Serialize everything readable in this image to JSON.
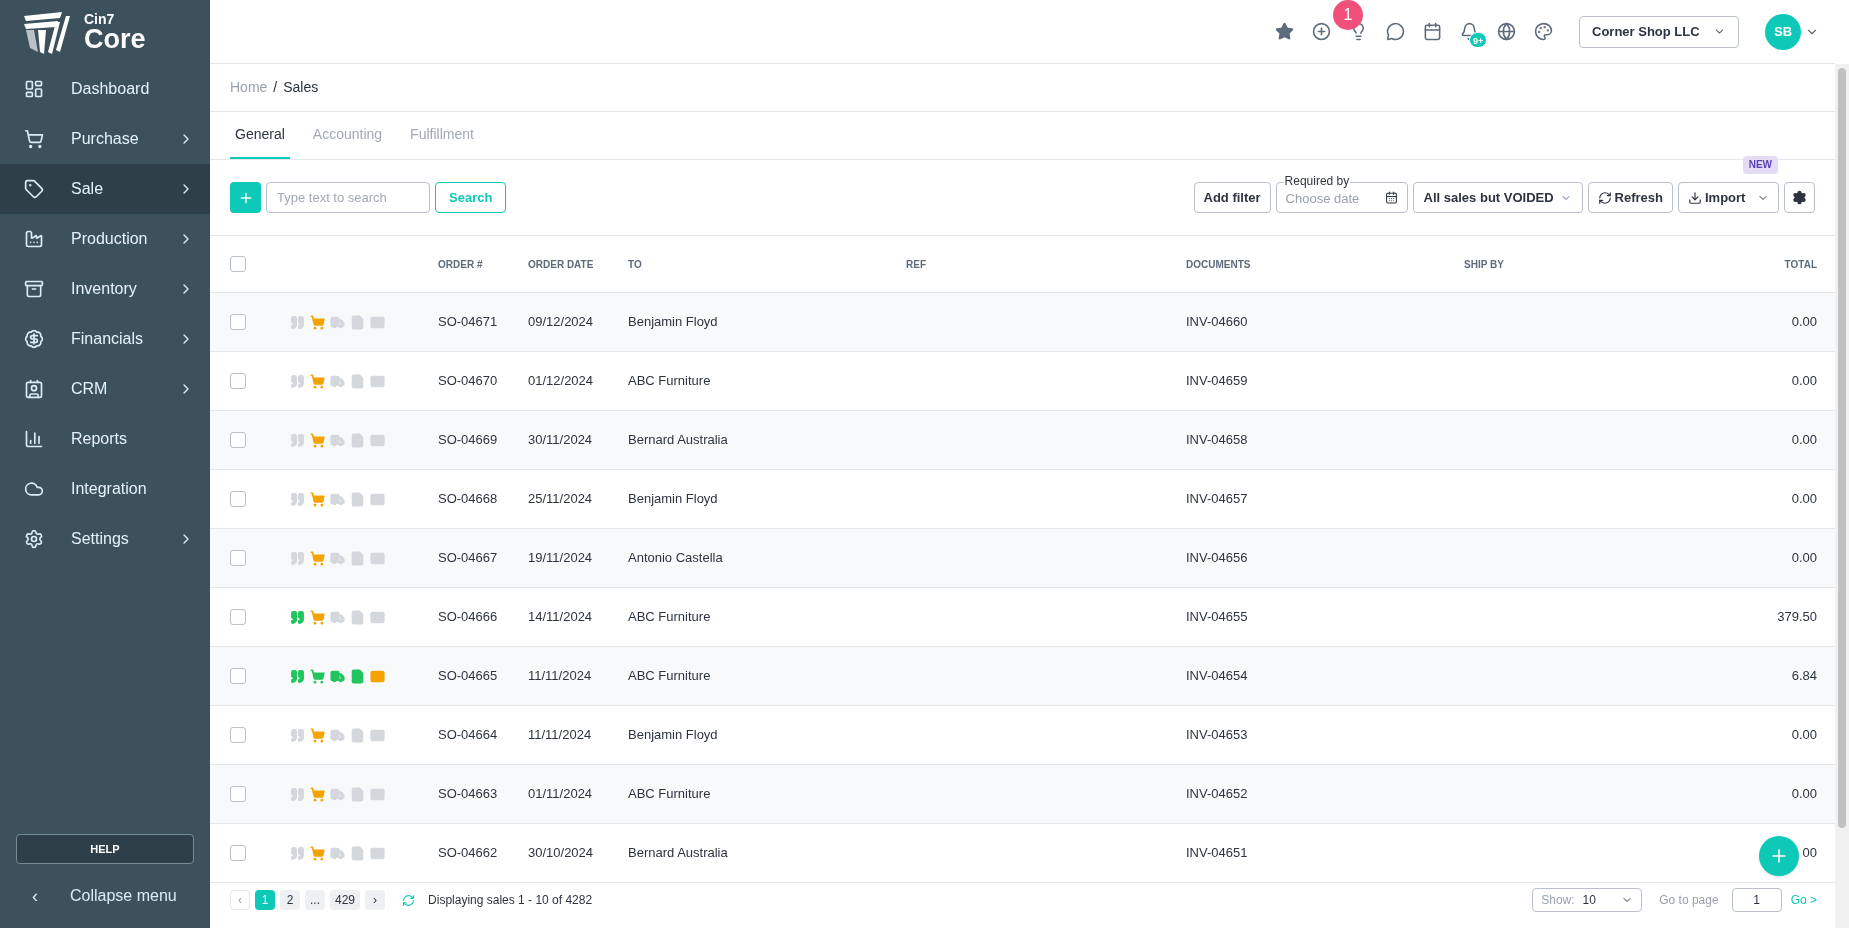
{
  "logo": {
    "small": "Cin7",
    "big": "Core"
  },
  "sidebar": {
    "items": [
      {
        "label": "Dashboard",
        "selected": false,
        "has_submenu": false
      },
      {
        "label": "Purchase",
        "selected": false,
        "has_submenu": true
      },
      {
        "label": "Sale",
        "selected": true,
        "has_submenu": true
      },
      {
        "label": "Production",
        "selected": false,
        "has_submenu": true
      },
      {
        "label": "Inventory",
        "selected": false,
        "has_submenu": true
      },
      {
        "label": "Financials",
        "selected": false,
        "has_submenu": true
      },
      {
        "label": "CRM",
        "selected": false,
        "has_submenu": true
      },
      {
        "label": "Reports",
        "selected": false,
        "has_submenu": false
      },
      {
        "label": "Integration",
        "selected": false,
        "has_submenu": false
      },
      {
        "label": "Settings",
        "selected": false,
        "has_submenu": true
      }
    ],
    "help": "HELP",
    "collapse": {
      "arrow": "‹",
      "label": "Collapse menu"
    }
  },
  "header": {
    "icons": [
      {
        "kind": "star"
      },
      {
        "kind": "add"
      },
      {
        "kind": "bulb",
        "badge": "1"
      },
      {
        "kind": "chat"
      },
      {
        "kind": "calendar"
      },
      {
        "kind": "bell",
        "badge": "9+"
      },
      {
        "kind": "globe"
      },
      {
        "kind": "palette"
      }
    ],
    "company": "Corner Shop LLC",
    "avatar": "SB"
  },
  "breadcrumb": {
    "items": [
      "Home",
      "Sales"
    ],
    "separator": "/"
  },
  "tabs": [
    {
      "label": "General",
      "selected": true
    },
    {
      "label": "Accounting",
      "selected": false
    },
    {
      "label": "Fulfillment",
      "selected": false
    }
  ],
  "toolbar": {
    "search": {
      "placeholder": "Type text to search"
    },
    "search_button": "Search",
    "add_filter": "Add filter",
    "date": {
      "label": "Required by",
      "placeholder": "Choose date"
    },
    "status_filter": "All sales but VOIDED",
    "refresh": "Refresh",
    "import": "Import",
    "import_badge": "NEW"
  },
  "table": {
    "select_all_checked": false,
    "columns": [
      "ORDER #",
      "ORDER DATE",
      "TO",
      "REF",
      "DOCUMENTS",
      "SHIP BY",
      "TOTAL"
    ],
    "rows": [
      {
        "checked": false,
        "stages": [
          {
            "color": "#d4d7dc"
          },
          {
            "color": "#f5a300"
          },
          {
            "color": "#d4d7dc"
          },
          {
            "color": "#d4d7dc"
          },
          {
            "color": "#d4d7dc"
          }
        ],
        "order": "SO-04671",
        "date": "09/12/2024",
        "to": "Benjamin Floyd",
        "documents": "INV-04660",
        "total": "0.00"
      },
      {
        "checked": false,
        "stages": [
          {
            "color": "#d4d7dc"
          },
          {
            "color": "#f5a300"
          },
          {
            "color": "#d4d7dc"
          },
          {
            "color": "#d4d7dc"
          },
          {
            "color": "#d4d7dc"
          }
        ],
        "order": "SO-04670",
        "date": "01/12/2024",
        "to": "ABC Furniture",
        "documents": "INV-04659",
        "total": "0.00"
      },
      {
        "checked": false,
        "stages": [
          {
            "color": "#d4d7dc"
          },
          {
            "color": "#f5a300"
          },
          {
            "color": "#d4d7dc"
          },
          {
            "color": "#d4d7dc"
          },
          {
            "color": "#d4d7dc"
          }
        ],
        "order": "SO-04669",
        "date": "30/11/2024",
        "to": "Bernard Australia",
        "documents": "INV-04658",
        "total": "0.00"
      },
      {
        "checked": false,
        "stages": [
          {
            "color": "#d4d7dc"
          },
          {
            "color": "#f5a300"
          },
          {
            "color": "#d4d7dc"
          },
          {
            "color": "#d4d7dc"
          },
          {
            "color": "#d4d7dc"
          }
        ],
        "order": "SO-04668",
        "date": "25/11/2024",
        "to": "Benjamin Floyd",
        "documents": "INV-04657",
        "total": "0.00"
      },
      {
        "checked": false,
        "stages": [
          {
            "color": "#d4d7dc"
          },
          {
            "color": "#f5a300"
          },
          {
            "color": "#d4d7dc"
          },
          {
            "color": "#d4d7dc"
          },
          {
            "color": "#d4d7dc"
          }
        ],
        "order": "SO-04667",
        "date": "19/11/2024",
        "to": "Antonio Castella",
        "documents": "INV-04656",
        "total": "0.00"
      },
      {
        "checked": false,
        "stages": [
          {
            "color": "#22c55e"
          },
          {
            "color": "#f5a300"
          },
          {
            "color": "#d4d7dc"
          },
          {
            "color": "#d4d7dc"
          },
          {
            "color": "#d4d7dc"
          }
        ],
        "order": "SO-04666",
        "date": "14/11/2024",
        "to": "ABC Furniture",
        "documents": "INV-04655",
        "total": "379.50"
      },
      {
        "checked": false,
        "stages": [
          {
            "color": "#22c55e"
          },
          {
            "color": "#22c55e"
          },
          {
            "color": "#22c55e"
          },
          {
            "color": "#22c55e"
          },
          {
            "color": "#f5a300"
          }
        ],
        "order": "SO-04665",
        "date": "11/11/2024",
        "to": "ABC Furniture",
        "documents": "INV-04654",
        "total": "6.84"
      },
      {
        "checked": false,
        "stages": [
          {
            "color": "#d4d7dc"
          },
          {
            "color": "#f5a300"
          },
          {
            "color": "#d4d7dc"
          },
          {
            "color": "#d4d7dc"
          },
          {
            "color": "#d4d7dc"
          }
        ],
        "order": "SO-04664",
        "date": "11/11/2024",
        "to": "Benjamin Floyd",
        "documents": "INV-04653",
        "total": "0.00"
      },
      {
        "checked": false,
        "stages": [
          {
            "color": "#d4d7dc"
          },
          {
            "color": "#f5a300"
          },
          {
            "color": "#d4d7dc"
          },
          {
            "color": "#d4d7dc"
          },
          {
            "color": "#d4d7dc"
          }
        ],
        "order": "SO-04663",
        "date": "01/11/2024",
        "to": "ABC Furniture",
        "documents": "INV-04652",
        "total": "0.00"
      },
      {
        "checked": false,
        "stages": [
          {
            "color": "#d4d7dc"
          },
          {
            "color": "#f5a300"
          },
          {
            "color": "#d4d7dc"
          },
          {
            "color": "#d4d7dc"
          },
          {
            "color": "#d4d7dc"
          }
        ],
        "order": "SO-04662",
        "date": "30/10/2024",
        "to": "Bernard Australia",
        "documents": "INV-04651",
        "total": "00"
      }
    ]
  },
  "pagination": {
    "prev": "‹",
    "pages": [
      {
        "label": "1",
        "selected": true
      },
      {
        "label": "2",
        "selected": false
      },
      {
        "label": "...",
        "selected": false
      },
      {
        "label": "429",
        "selected": false
      }
    ],
    "next": "›",
    "summary": "Displaying sales 1 - 10 of 4282",
    "show_label": "Show:",
    "show_value": "10",
    "goto_label": "Go to page",
    "goto_value": "1",
    "go": "Go >"
  }
}
